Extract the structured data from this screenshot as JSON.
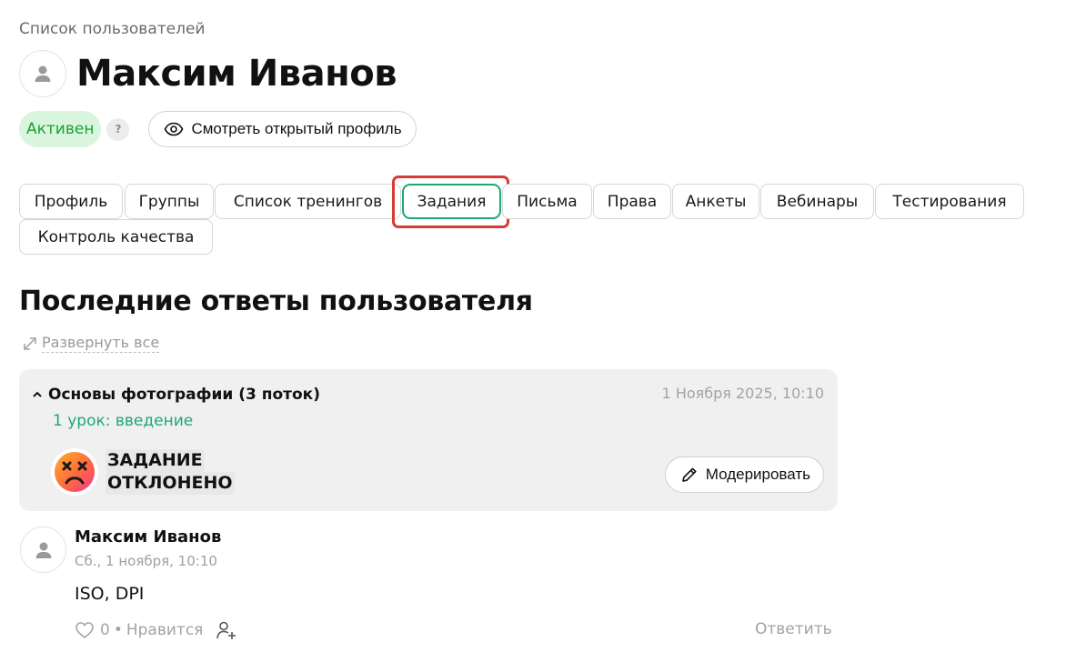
{
  "breadcrumb": "Список пользователей",
  "user": {
    "name": "Максим Иванов"
  },
  "status": {
    "label": "Активен",
    "help": "?"
  },
  "public_profile_button": "Смотреть открытый профиль",
  "tabs": [
    {
      "label": "Профиль"
    },
    {
      "label": "Группы"
    },
    {
      "label": "Список тренингов"
    },
    {
      "label": "Задания",
      "active": true
    },
    {
      "label": "Письма"
    },
    {
      "label": "Права"
    },
    {
      "label": "Анкеты"
    },
    {
      "label": "Вебинары"
    },
    {
      "label": "Тестирования"
    },
    {
      "label": "Контроль качества"
    }
  ],
  "section": {
    "title": "Последние ответы пользователя",
    "expand_all": "Развернуть все"
  },
  "answer_card": {
    "course": "Основы фотографии (3 поток)",
    "date": "1 Ноября 2025, 10:10",
    "lesson": "1 урок: введение",
    "status_line1": "ЗАДАНИЕ",
    "status_line2": "ОТКЛОНЕНО",
    "moderate_button": "Модерировать"
  },
  "comment": {
    "author": "Максим Иванов",
    "time": "Сб., 1 ноября, 10:10",
    "text": "ISO, DPI",
    "likes": "0",
    "separator": "•",
    "like_label": "Нравится",
    "reply_label": "Ответить"
  },
  "colors": {
    "accent_green": "#1ba87a",
    "status_green": "#19a232",
    "status_bg": "#d9f5de",
    "highlight_red": "#d93a33"
  },
  "icons": {
    "avatar": "user-silhouette-icon",
    "eye": "eye-icon",
    "expand": "expand-arrows-icon",
    "collapse": "chevron-up-icon",
    "rejected": "dizzy-face-icon",
    "pencil": "pencil-icon",
    "like": "heart-icon",
    "mention": "add-user-icon"
  }
}
